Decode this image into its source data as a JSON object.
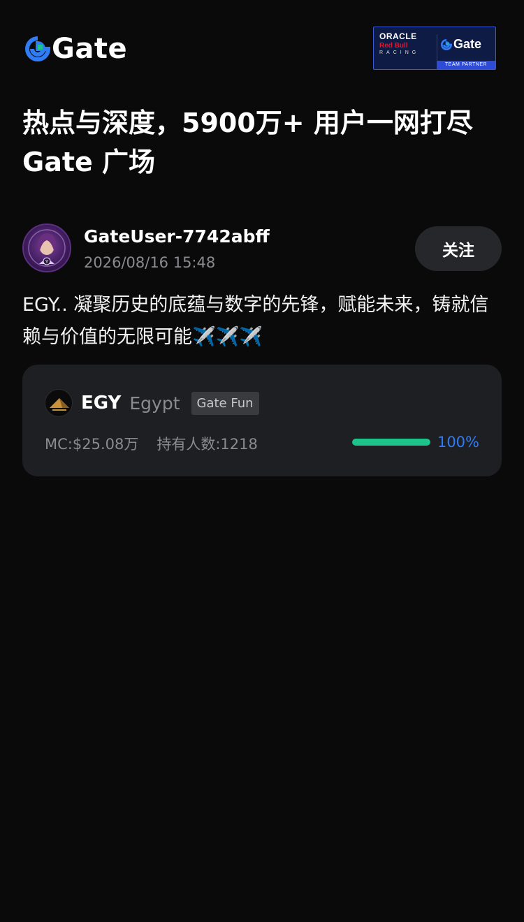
{
  "header": {
    "logo_text": "Gate",
    "logo_icon": "gate-logo-icon",
    "partner": {
      "oracle": "ORACLE",
      "redbull": "Red Bull",
      "racing": "RACING",
      "gate_text": "Gate",
      "footer": "TEAM PARTNER"
    }
  },
  "headline": "热点与深度，5900万+ 用户一网打尽 Gate 广场",
  "post": {
    "username": "GateUser-7742abff",
    "timestamp": "2026/08/16 15:48",
    "follow_label": "关注",
    "text": "EGY.. 凝聚历史的底蕴与数字的先锋，赋能未来，铸就信赖与价值的无限可能✈️✈️✈️"
  },
  "token_card": {
    "symbol": "EGY",
    "name": "Egypt",
    "tag": "Gate Fun",
    "market_cap": "MC:$25.08万",
    "holders": "持有人数:1218",
    "progress_pct": "100%",
    "progress_value": 1.0,
    "progress_color": "#1cc38a",
    "pct_color": "#2f7cf6"
  }
}
